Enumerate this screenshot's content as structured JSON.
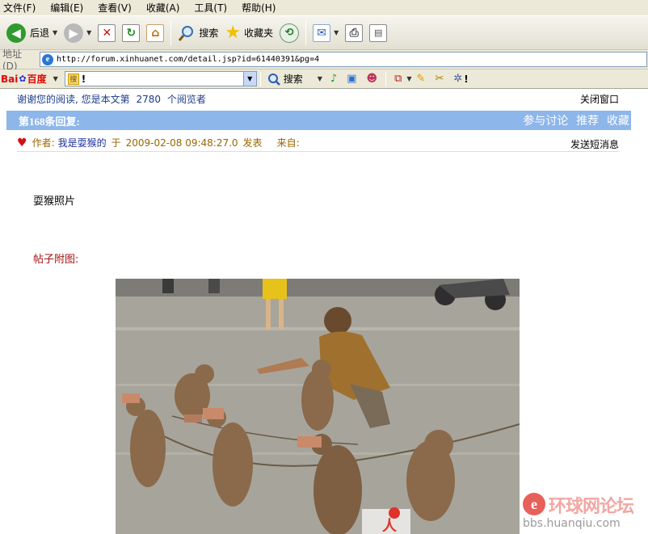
{
  "menu": [
    "文件(F)",
    "编辑(E)",
    "查看(V)",
    "收藏(A)",
    "工具(T)",
    "帮助(H)"
  ],
  "toolbar": {
    "back": "后退",
    "search": "搜索",
    "favorites": "收藏夹"
  },
  "address": {
    "label": "地址 (D)",
    "url": "http://forum.xinhuanet.com/detail.jsp?id=61440391&pg=4"
  },
  "baidu": {
    "logo_left": "Bai",
    "logo_right": "百度",
    "input_value": "!",
    "search": "搜索"
  },
  "page": {
    "thanks_prefix": "谢谢您的阅读, 您是本文第",
    "reader_count": "2780",
    "thanks_suffix": "个阅览者",
    "close_window": "关闭窗口",
    "reply_title": "第168条回复:",
    "actions": [
      "参与讨论",
      "推荐",
      "收藏"
    ],
    "author_label": "作者:",
    "author": "我是耍猴的",
    "at": "于",
    "datetime": "2009-02-08 09:48:27.0",
    "posted": "发表",
    "from_label": "来自:",
    "send_message": "发送短消息",
    "post_text": "耍猴照片",
    "attachment_label": "帖子附图:"
  },
  "watermark": {
    "brand": "环球网论坛",
    "domain": "bbs.huanqiu.com"
  },
  "colors": {
    "reply_bar": "#8db6ea",
    "link_blue": "#1c3b86",
    "attach_red": "#a31515"
  }
}
